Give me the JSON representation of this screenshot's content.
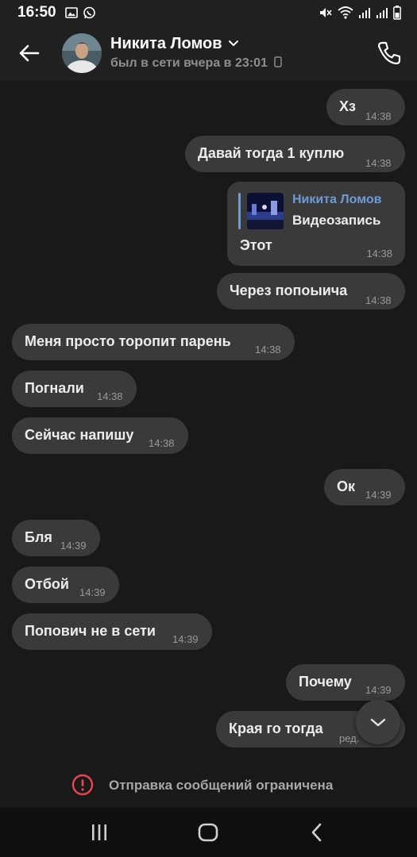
{
  "status_bar": {
    "time": "16:50"
  },
  "header": {
    "name": "Никита Ломов",
    "status": "был в сети вчера в 23:01"
  },
  "messages": [
    {
      "dir": "out",
      "text": "Хз",
      "time": "14:38"
    },
    {
      "dir": "out",
      "text": "Давай тогда 1 куплю",
      "time": "14:38"
    },
    {
      "dir": "out",
      "reply": {
        "author": "Никита Ломов",
        "kind": "Видеозапись"
      },
      "text": "Этот",
      "time": "14:38"
    },
    {
      "dir": "out",
      "text": "Через попоыича",
      "time": "14:38"
    },
    {
      "dir": "in",
      "text": "Меня просто торопит парень",
      "time": "14:38"
    },
    {
      "dir": "in",
      "text": "Погнали",
      "time": "14:38"
    },
    {
      "dir": "in",
      "text": "Сейчас напишу",
      "time": "14:38"
    },
    {
      "dir": "out",
      "text": "Ок",
      "time": "14:39"
    },
    {
      "dir": "in",
      "text": "Бля",
      "time": "14:39"
    },
    {
      "dir": "in",
      "text": "Отбой",
      "time": "14:39"
    },
    {
      "dir": "in",
      "text": "Попович не в сети",
      "time": "14:39"
    },
    {
      "dir": "out",
      "text": "Почему",
      "time": "14:39"
    },
    {
      "dir": "out",
      "text": "Края го тогда",
      "time": "ред."
    }
  ],
  "restriction": {
    "text": "Отправка сообщений ограничена"
  },
  "icons": {
    "back": "arrow-left-icon",
    "call": "phone-icon",
    "scroll": "chevron-down-icon",
    "warning": "exclamation-circle-icon",
    "nav_recent": "recent-apps-icon",
    "nav_home": "home-icon",
    "nav_back": "back-chevron-icon"
  },
  "colors": {
    "background": "#191919",
    "bubble": "#3a3a3a",
    "accent": "#6e9bd6",
    "warning": "#e8474d"
  }
}
